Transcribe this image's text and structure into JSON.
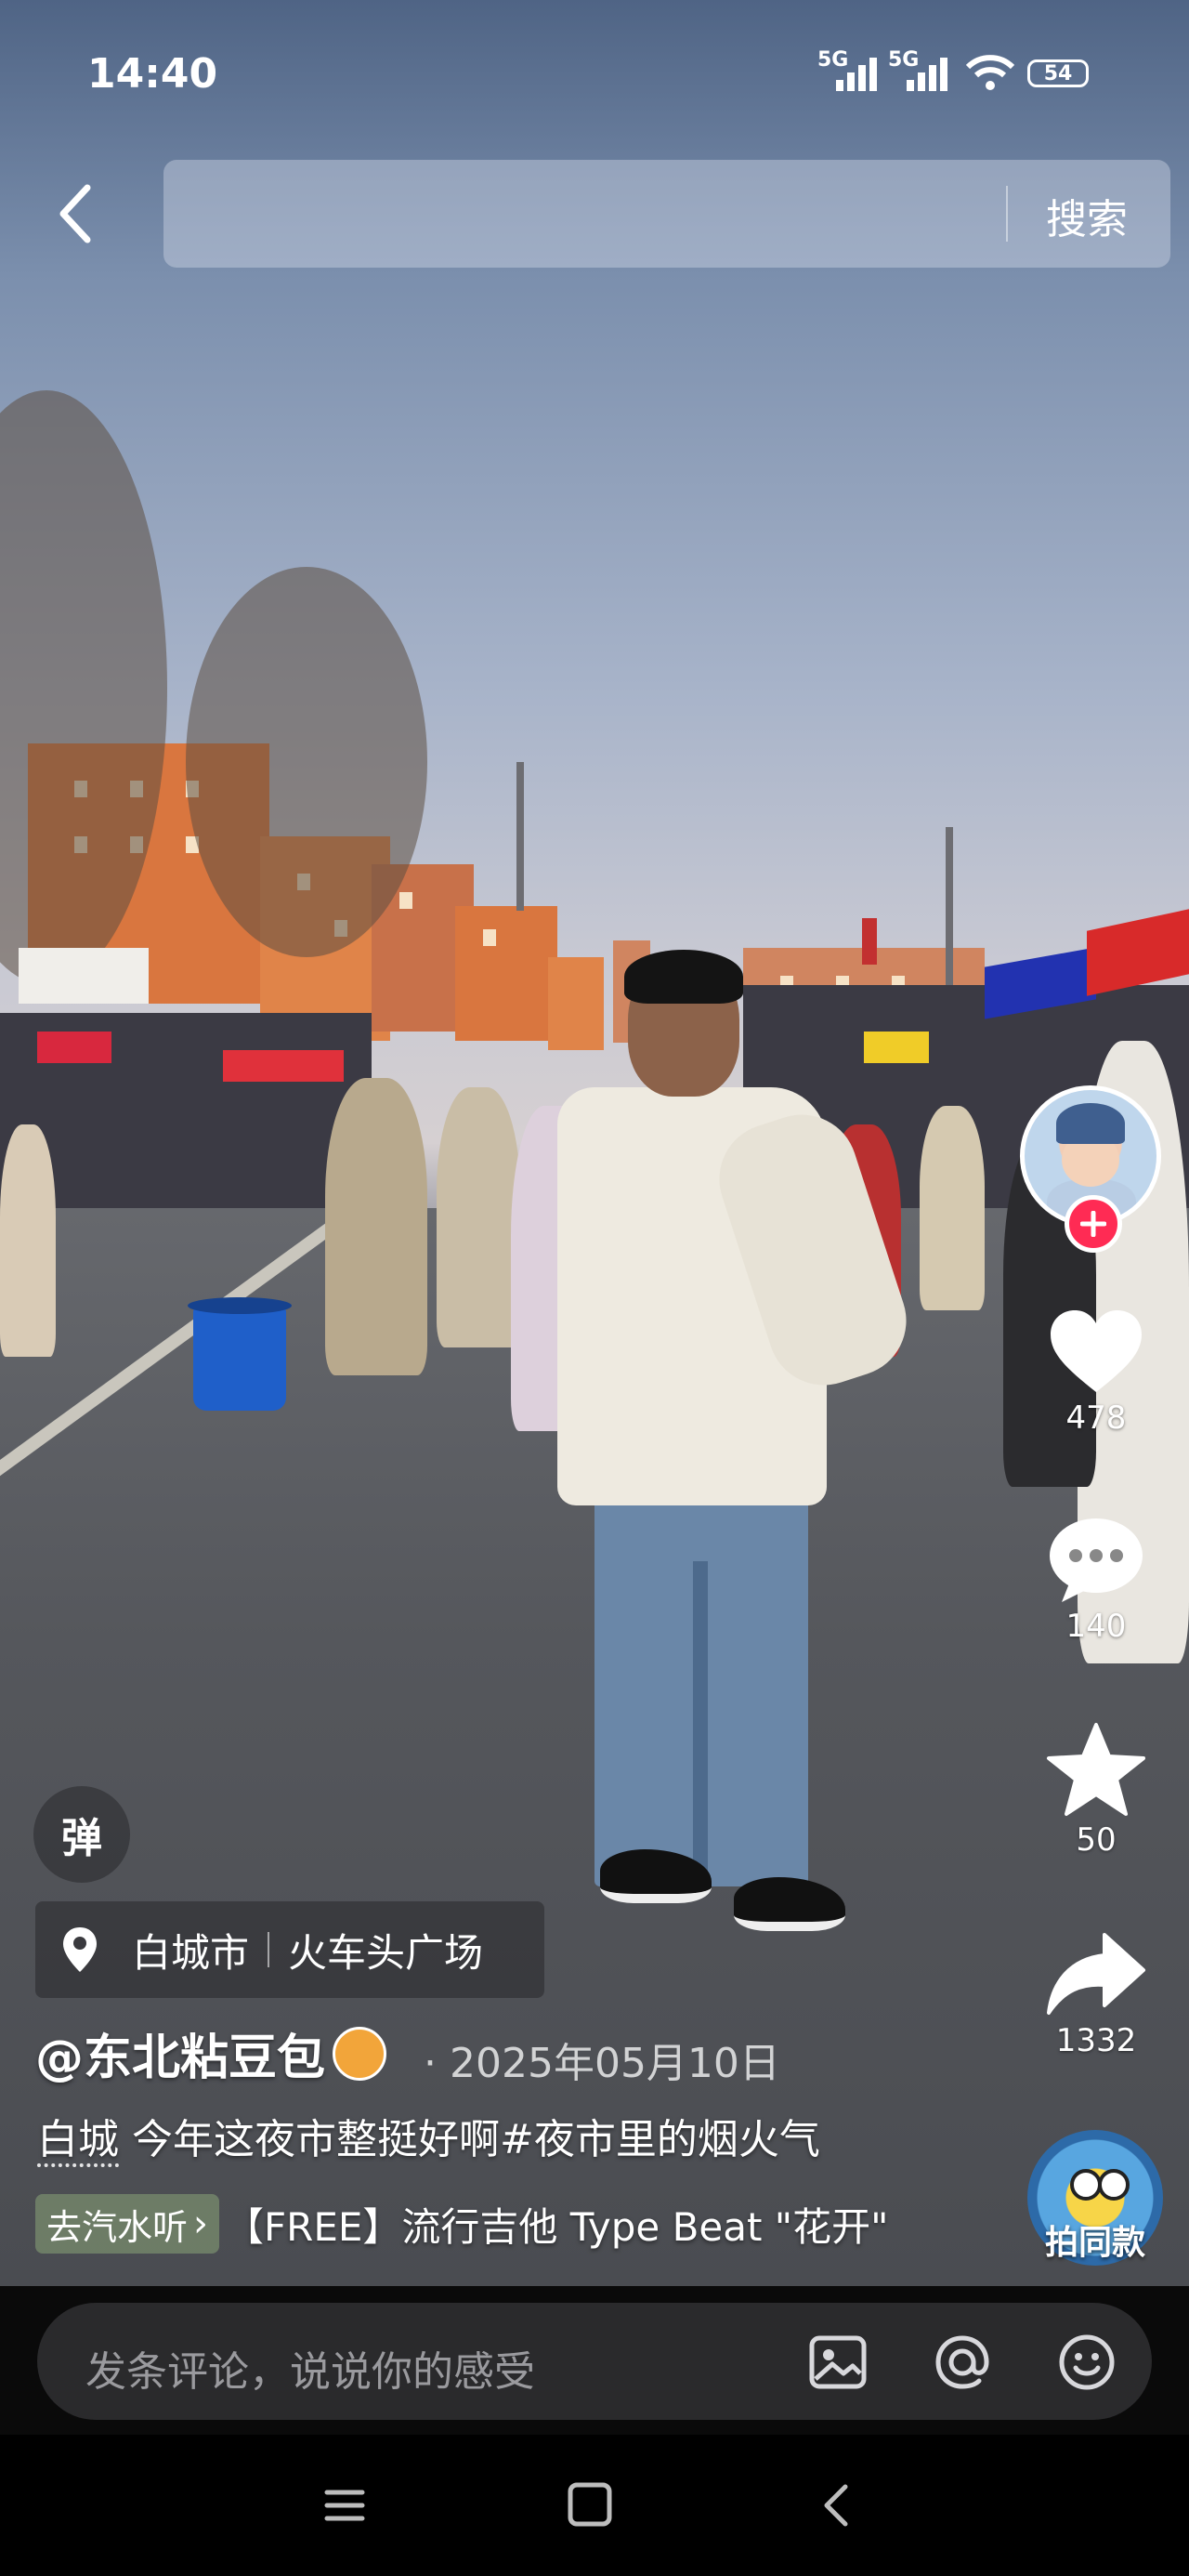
{
  "status_bar": {
    "time": "14:40",
    "network1": "5G",
    "network2": "5G",
    "battery": "54",
    "icons": [
      "signal-icon",
      "signal-icon",
      "wifi-icon",
      "battery-icon"
    ]
  },
  "header": {
    "back_icon": "back-arrow-icon",
    "search_placeholder": "",
    "search_button": "搜索"
  },
  "video": {
    "description_icons": [
      "video-scene"
    ]
  },
  "actions": {
    "follow_icon": "plus-icon",
    "like_count": "478",
    "comment_count": "140",
    "favorite_count": "50",
    "share_count": "1332",
    "music_label": "拍同款"
  },
  "danmaku": {
    "label": "弹"
  },
  "location": {
    "city": "白城市",
    "place": "火车头广场",
    "icon": "location-pin-icon"
  },
  "author": {
    "name": "@东北粘豆包",
    "date": "· 2025年05月10日"
  },
  "caption": {
    "highlight": "白城",
    "text": " 今年这夜市整挺好啊#夜市里的烟火气"
  },
  "music": {
    "chip_label": "去汽水听",
    "chip_arrow": "›",
    "title": "【FREE】流行吉他 Type Beat \"花开\""
  },
  "comment_bar": {
    "placeholder": "发条评论，说说你的感受",
    "icons": [
      "image-icon",
      "at-icon",
      "emoji-icon"
    ]
  },
  "nav_bar": {
    "icons": [
      "menu-icon",
      "home-icon",
      "back-icon"
    ]
  },
  "colors": {
    "follow_accent": "#ff2b54",
    "comment_bg": "#2a2a2c",
    "music_chip": "#788c6e"
  }
}
